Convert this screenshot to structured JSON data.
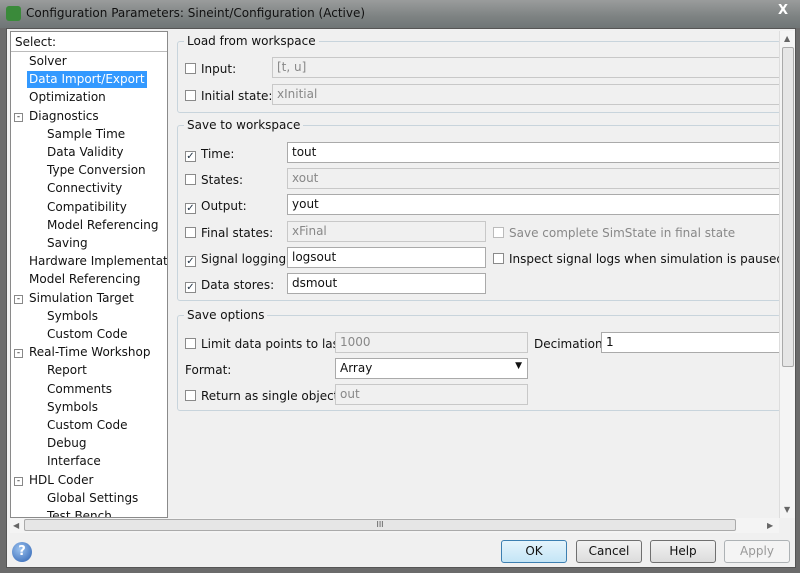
{
  "window": {
    "title": "Configuration Parameters: Sineint/Configuration (Active)",
    "close": "X"
  },
  "tree": {
    "header": "Select:",
    "items": [
      {
        "label": "Solver",
        "level": 0,
        "selected": false
      },
      {
        "label": "Data Import/Export",
        "level": 0,
        "selected": true
      },
      {
        "label": "Optimization",
        "level": 0
      },
      {
        "label": "Diagnostics",
        "level": 0,
        "expander": "-"
      },
      {
        "label": "Sample Time",
        "level": 1
      },
      {
        "label": "Data Validity",
        "level": 1
      },
      {
        "label": "Type Conversion",
        "level": 1
      },
      {
        "label": "Connectivity",
        "level": 1
      },
      {
        "label": "Compatibility",
        "level": 1
      },
      {
        "label": "Model Referencing",
        "level": 1
      },
      {
        "label": "Saving",
        "level": 1
      },
      {
        "label": "Hardware Implementati...",
        "level": 0
      },
      {
        "label": "Model Referencing",
        "level": 0
      },
      {
        "label": "Simulation Target",
        "level": 0,
        "expander": "-"
      },
      {
        "label": "Symbols",
        "level": 1
      },
      {
        "label": "Custom Code",
        "level": 1
      },
      {
        "label": "Real-Time Workshop",
        "level": 0,
        "expander": "-"
      },
      {
        "label": "Report",
        "level": 1
      },
      {
        "label": "Comments",
        "level": 1
      },
      {
        "label": "Symbols",
        "level": 1
      },
      {
        "label": "Custom Code",
        "level": 1
      },
      {
        "label": "Debug",
        "level": 1
      },
      {
        "label": "Interface",
        "level": 1
      },
      {
        "label": "HDL Coder",
        "level": 0,
        "expander": "-"
      },
      {
        "label": "Global Settings",
        "level": 1
      },
      {
        "label": "Test Bench",
        "level": 1
      }
    ]
  },
  "load": {
    "title": "Load from workspace",
    "input": {
      "label": "Input:",
      "checked": false,
      "value": "[t, u]"
    },
    "initial": {
      "label": "Initial state:",
      "checked": false,
      "value": "xInitial"
    }
  },
  "save": {
    "title": "Save to workspace",
    "time": {
      "label": "Time:",
      "checked": true,
      "value": "tout"
    },
    "states": {
      "label": "States:",
      "checked": false,
      "value": "xout"
    },
    "output": {
      "label": "Output:",
      "checked": true,
      "value": "yout"
    },
    "final": {
      "label": "Final states:",
      "checked": false,
      "value": "xFinal"
    },
    "simstate": {
      "label": "Save complete SimState in final state",
      "checked": false
    },
    "siglog": {
      "label": "Signal logging:",
      "checked": true,
      "value": "logsout"
    },
    "inspect": {
      "label": "Inspect signal logs when simulation is paused/stopp",
      "checked": false
    },
    "dstores": {
      "label": "Data stores:",
      "checked": true,
      "value": "dsmout"
    }
  },
  "options": {
    "title": "Save options",
    "limit": {
      "label": "Limit data points to last:",
      "checked": false,
      "value": "1000"
    },
    "decimation": {
      "label": "Decimation:",
      "value": "1"
    },
    "format": {
      "label": "Format:",
      "value": "Array"
    },
    "single": {
      "label": "Return as single object:",
      "checked": false,
      "value": "out"
    }
  },
  "buttons": {
    "ok": "OK",
    "cancel": "Cancel",
    "help": "Help",
    "apply": "Apply"
  },
  "scroll": {
    "grip": "III"
  }
}
